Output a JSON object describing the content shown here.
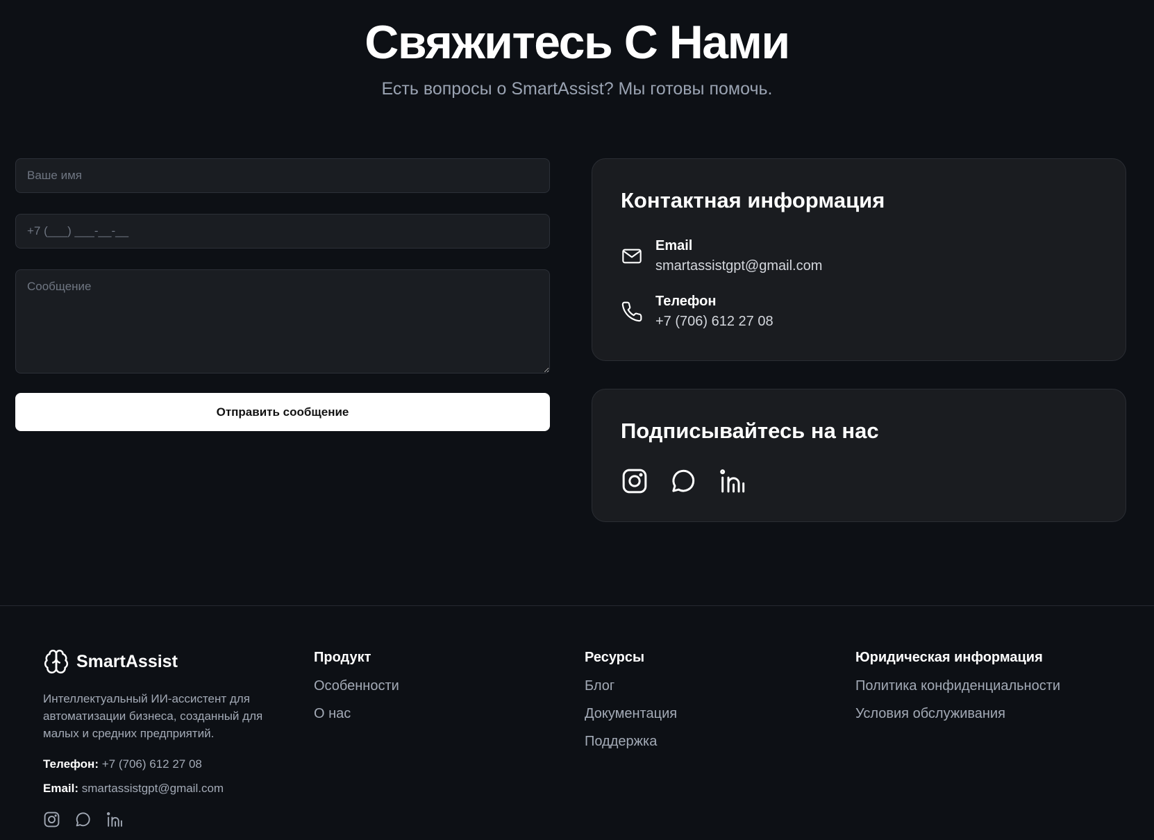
{
  "hero": {
    "title": "Свяжитесь С Нами",
    "subtitle": "Есть вопросы о SmartAssist? Мы готовы помочь."
  },
  "form": {
    "name_placeholder": "Ваше имя",
    "phone_placeholder": "+7 (___) ___-__-__",
    "message_placeholder": "Сообщение",
    "submit_label": "Отправить сообщение"
  },
  "contact_card": {
    "title": "Контактная информация",
    "email_label": "Email",
    "email_value": "smartassistgpt@gmail.com",
    "email_icon": "mail-icon",
    "phone_label": "Телефон",
    "phone_value": "+7 (706) 612 27 08",
    "phone_icon": "phone-icon"
  },
  "social_card": {
    "title": "Подписывайтесь на нас",
    "icons": [
      "instagram-icon",
      "whatsapp-icon",
      "linkedin-icon"
    ]
  },
  "footer": {
    "brand_name": "SmartAssist",
    "brand_icon": "brain-icon",
    "description": "Интеллектуальный ИИ-ассистент для автоматизации бизнеса, созданный для малых и средних предприятий.",
    "phone_label": "Телефон:",
    "phone_value": "+7 (706) 612 27 08",
    "email_label": "Email:",
    "email_value": "smartassistgpt@gmail.com",
    "columns": [
      {
        "title": "Продукт",
        "links": [
          "Особенности",
          "О нас"
        ]
      },
      {
        "title": "Ресурсы",
        "links": [
          "Блог",
          "Документация",
          "Поддержка"
        ]
      },
      {
        "title": "Юридическая информация",
        "links": [
          "Политика конфиденциальности",
          "Условия обслуживания"
        ]
      }
    ]
  },
  "colors": {
    "background": "#0d1015",
    "card": "#1a1c20",
    "muted_text": "#a3aab6",
    "button": "#ffffff"
  }
}
